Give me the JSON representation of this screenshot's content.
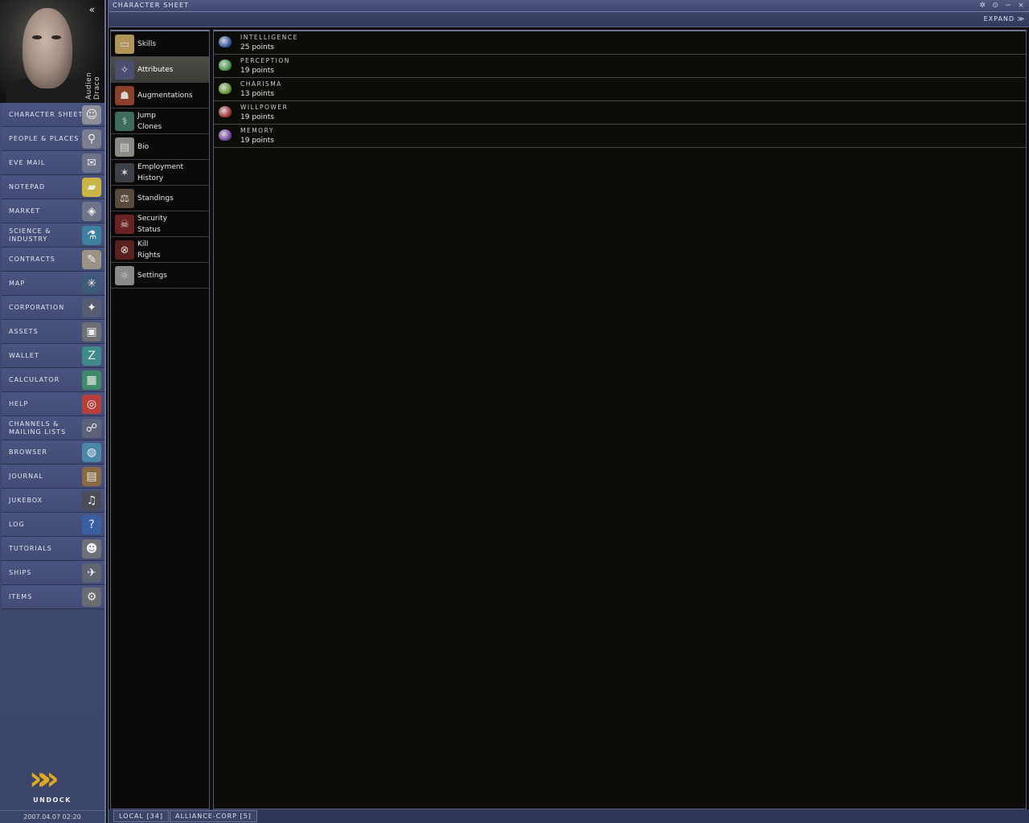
{
  "character": {
    "name": "Audien Draco"
  },
  "neocom": {
    "collapse_glyph": "«",
    "items": [
      {
        "id": "character-sheet",
        "label": "CHARACTER SHEET",
        "icon": "vitruvian-icon",
        "glyph": "☺",
        "color": "#8c8f9a"
      },
      {
        "id": "people-places",
        "label": "PEOPLE & PLACES",
        "icon": "people-icon",
        "glyph": "⚲",
        "color": "#7a7f90"
      },
      {
        "id": "eve-mail",
        "label": "EVE MAIL",
        "icon": "envelope-icon",
        "glyph": "✉",
        "color": "#6d738a"
      },
      {
        "id": "notepad",
        "label": "NOTEPAD",
        "icon": "notepad-icon",
        "glyph": "▰",
        "color": "#c9b545"
      },
      {
        "id": "market",
        "label": "MARKET",
        "icon": "market-icon",
        "glyph": "◈",
        "color": "#6e7588"
      },
      {
        "id": "science-industry",
        "label": "SCIENCE &\nINDUSTRY",
        "icon": "science-icon",
        "glyph": "⚗",
        "color": "#3f7fa0"
      },
      {
        "id": "contracts",
        "label": "CONTRACTS",
        "icon": "contract-icon",
        "glyph": "✎",
        "color": "#9a9486"
      },
      {
        "id": "map",
        "label": "MAP",
        "icon": "starmap-icon",
        "glyph": "✳",
        "color": "#3e5a7a"
      },
      {
        "id": "corporation",
        "label": "CORPORATION",
        "icon": "corporation-icon",
        "glyph": "✦",
        "color": "#555c74"
      },
      {
        "id": "assets",
        "label": "ASSETS",
        "icon": "safe-icon",
        "glyph": "▣",
        "color": "#6e6f74"
      },
      {
        "id": "wallet",
        "label": "WALLET",
        "icon": "wallet-icon",
        "glyph": "Z",
        "color": "#3f8a8a"
      },
      {
        "id": "calculator",
        "label": "CALCULATOR",
        "icon": "calculator-icon",
        "glyph": "▦",
        "color": "#3f8a6a"
      },
      {
        "id": "help",
        "label": "HELP",
        "icon": "lifebuoy-icon",
        "glyph": "◎",
        "color": "#b8403a"
      },
      {
        "id": "channels",
        "label": "CHANNELS &\nMAILING LISTS",
        "icon": "channels-icon",
        "glyph": "☍",
        "color": "#5c6278"
      },
      {
        "id": "browser",
        "label": "BROWSER",
        "icon": "globe-icon",
        "glyph": "◍",
        "color": "#4a87a8"
      },
      {
        "id": "journal",
        "label": "JOURNAL",
        "icon": "journal-icon",
        "glyph": "▤",
        "color": "#8a6a45"
      },
      {
        "id": "jukebox",
        "label": "JUKEBOX",
        "icon": "headphones-icon",
        "glyph": "♫",
        "color": "#4a4d58"
      },
      {
        "id": "log",
        "label": "LOG",
        "icon": "info-icon",
        "glyph": "?",
        "color": "#3a5fa0"
      },
      {
        "id": "tutorials",
        "label": "TUTORIALS",
        "icon": "tutorial-face-icon",
        "glyph": "☻",
        "color": "#6e707a"
      },
      {
        "id": "ships",
        "label": "SHIPS",
        "icon": "ship-icon",
        "glyph": "✈",
        "color": "#5e6474"
      },
      {
        "id": "items",
        "label": "ITEMS",
        "icon": "items-icon",
        "glyph": "⚙",
        "color": "#6a6c72"
      }
    ],
    "undock_label": "UNDOCK",
    "undock_glyph": "»»",
    "clock": "2007.04.07  02:20"
  },
  "window": {
    "title": "CHARACTER SHEET",
    "buttons": [
      "✲",
      "⊙",
      "−",
      "×"
    ],
    "expand_label": "EXPAND ≫",
    "tabs": [
      {
        "label": "Skills",
        "icon": "skillbook-icon",
        "glyph": "▭",
        "color": "#b09458"
      },
      {
        "label": "Attributes",
        "icon": "attributes-icon",
        "glyph": "✧",
        "color": "#4a4e70"
      },
      {
        "label": "Augmentations",
        "icon": "implant-head-icon",
        "glyph": "☗",
        "color": "#8a3f2a"
      },
      {
        "label": "Jump\nClones",
        "icon": "clone-icon",
        "glyph": "⚕",
        "color": "#3d6c5a"
      },
      {
        "label": "Bio",
        "icon": "bio-icon",
        "glyph": "▤",
        "color": "#8a8a86"
      },
      {
        "label": "Employment\nHistory",
        "icon": "employment-icon",
        "glyph": "✶",
        "color": "#3e4048"
      },
      {
        "label": "Standings",
        "icon": "standings-icon",
        "glyph": "⚖",
        "color": "#5a4a3e"
      },
      {
        "label": "Security\nStatus",
        "icon": "security-skull-icon",
        "glyph": "☠",
        "color": "#6a2222"
      },
      {
        "label": "Kill\nRights",
        "icon": "kill-rights-icon",
        "glyph": "⊗",
        "color": "#5a2020"
      },
      {
        "label": "Settings",
        "icon": "settings-icon",
        "glyph": "☼",
        "color": "#8a8a8a"
      }
    ],
    "active_tab": 1,
    "attributes": [
      {
        "name": "INTELLIGENCE",
        "points": "25 points",
        "icon": "intelligence-icon",
        "color": "#3c5aa8"
      },
      {
        "name": "PERCEPTION",
        "points": "19 points",
        "icon": "perception-icon",
        "color": "#4a9a4a"
      },
      {
        "name": "CHARISMA",
        "points": "13 points",
        "icon": "charisma-icon",
        "color": "#6a9a3a"
      },
      {
        "name": "WILLPOWER",
        "points": "19 points",
        "icon": "willpower-icon",
        "color": "#a83c3c"
      },
      {
        "name": "MEMORY",
        "points": "19 points",
        "icon": "memory-icon",
        "color": "#7a4aa8"
      }
    ],
    "channel_tabs": [
      "LOCAL [34]",
      "ALLIANCE-CORP [5]"
    ]
  }
}
